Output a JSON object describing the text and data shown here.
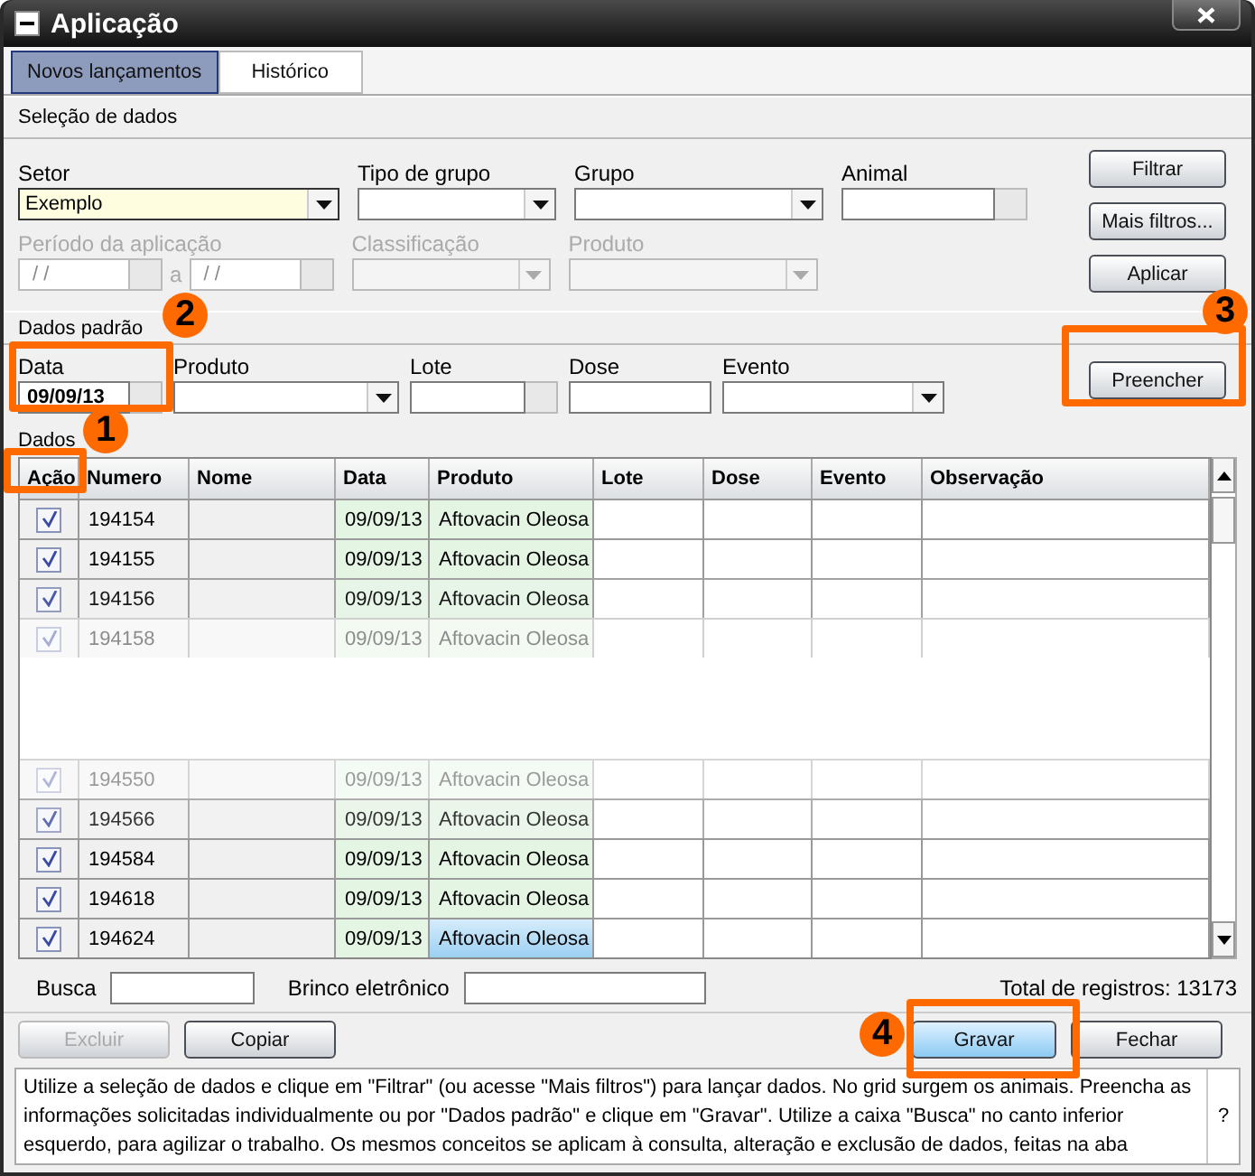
{
  "window": {
    "title": "Aplicação"
  },
  "tabs": [
    {
      "label": "Novos lançamentos",
      "selected": true
    },
    {
      "label": "Histórico",
      "selected": false
    }
  ],
  "selection": {
    "title": "Seleção de dados",
    "row1": [
      {
        "label": "Setor",
        "kind": "combo",
        "value": "Exemplo",
        "focused": true,
        "disabled": false
      },
      {
        "label": "Tipo de grupo",
        "kind": "combo",
        "focused": false,
        "disabled": false
      },
      {
        "label": "Grupo",
        "kind": "combo",
        "focused": false,
        "disabled": false
      },
      {
        "label": "Animal",
        "kind": "lookup",
        "focused": false,
        "disabled": false
      }
    ],
    "row2": [
      {
        "label": "Período da aplicação",
        "kind": "range",
        "from": " / /",
        "separator": "a",
        "to": " / /",
        "disabled": true
      },
      {
        "label": "Classificação",
        "kind": "combo",
        "disabled": true
      },
      {
        "label": "Produto",
        "kind": "combo",
        "disabled": true
      }
    ],
    "buttons": [
      "Filtrar",
      "Mais filtros...",
      "Aplicar"
    ]
  },
  "defaults": {
    "title": "Dados padrão",
    "fields": [
      {
        "label": "Data",
        "kind": "lookup",
        "value": "09/09/13"
      },
      {
        "label": "Produto",
        "kind": "combo"
      },
      {
        "label": "Lote",
        "kind": "lookup"
      },
      {
        "label": "Dose",
        "kind": "text"
      },
      {
        "label": "Evento",
        "kind": "combo"
      }
    ],
    "button": "Preencher"
  },
  "table": {
    "title": "Dados",
    "columns": [
      "Ação",
      "Numero",
      "Nome",
      "Data",
      "Produto",
      "Lote",
      "Dose",
      "Evento",
      "Observação"
    ],
    "rows_top": [
      {
        "checked": true,
        "numero": "194154",
        "data": "09/09/13",
        "produto": "Aftovacin Oleosa",
        "selected": false
      },
      {
        "checked": true,
        "numero": "194155",
        "data": "09/09/13",
        "produto": "Aftovacin Oleosa",
        "selected": false
      },
      {
        "checked": true,
        "numero": "194156",
        "data": "09/09/13",
        "produto": "Aftovacin Oleosa",
        "selected": false
      },
      {
        "checked": true,
        "numero": "194158",
        "data": "09/09/13",
        "produto": "Aftovacin Oleosa",
        "selected": false
      }
    ],
    "rows_bottom": [
      {
        "checked": true,
        "numero": "194550",
        "data": "09/09/13",
        "produto": "Aftovacin Oleosa",
        "selected": false
      },
      {
        "checked": true,
        "numero": "194566",
        "data": "09/09/13",
        "produto": "Aftovacin Oleosa",
        "selected": false
      },
      {
        "checked": true,
        "numero": "194584",
        "data": "09/09/13",
        "produto": "Aftovacin Oleosa",
        "selected": false
      },
      {
        "checked": true,
        "numero": "194618",
        "data": "09/09/13",
        "produto": "Aftovacin Oleosa",
        "selected": false
      },
      {
        "checked": true,
        "numero": "194624",
        "data": "09/09/13",
        "produto": "Aftovacin Oleosa",
        "selected": true
      }
    ]
  },
  "footer": {
    "search_label": "Busca",
    "tag_label": "Brinco eletrônico",
    "total": "Total de registros: 13173"
  },
  "buttons": [
    {
      "label": "Excluir",
      "disabled": true,
      "default": false
    },
    {
      "label": "Copiar",
      "disabled": false,
      "default": false
    },
    {
      "label": "Gravar",
      "disabled": false,
      "default": true
    },
    {
      "label": "Fechar",
      "disabled": false,
      "default": false
    }
  ],
  "help": {
    "text": "Utilize a seleção de dados e clique em \"Filtrar\" (ou acesse \"Mais filtros\") para lançar dados. No grid surgem os animais. Preencha as informações solicitadas individualmente ou por \"Dados padrão\" e clique em  \"Gravar\". Utilize a caixa \"Busca\" no canto inferior esquerdo, para agilizar o trabalho. Os mesmos conceitos se aplicam à consulta, alteração e exclusão de dados, feitas na aba",
    "button": "?"
  },
  "callouts": [
    {
      "number": "1"
    },
    {
      "number": "2"
    },
    {
      "number": "3"
    },
    {
      "number": "4"
    }
  ]
}
